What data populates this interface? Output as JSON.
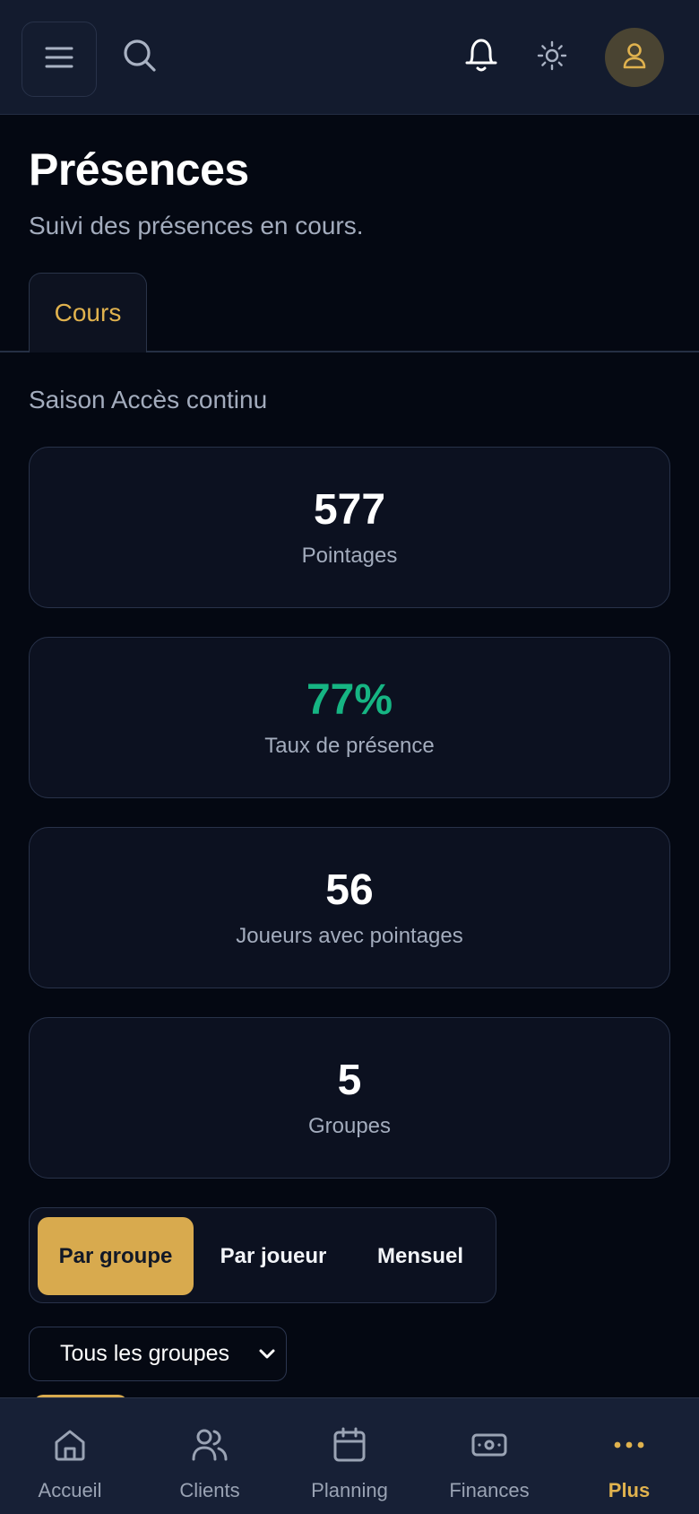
{
  "topbar": {
    "menu_icon": "hamburger-icon",
    "search_icon": "search-icon",
    "notification_icon": "bell-icon",
    "theme_icon": "sun-icon",
    "avatar_icon": "user-icon"
  },
  "header": {
    "title": "Présences",
    "subtitle": "Suivi des présences en cours."
  },
  "tabs": [
    {
      "label": "Cours",
      "active": true
    }
  ],
  "season": "Saison Accès continu",
  "stats": [
    {
      "value": "577",
      "label": "Pointages"
    },
    {
      "value": "77%",
      "label": "Taux de présence"
    },
    {
      "value": "56",
      "label": "Joueurs avec pointages"
    },
    {
      "value": "5",
      "label": "Groupes"
    }
  ],
  "view_switch": {
    "options": [
      "Par groupe",
      "Par joueur",
      "Mensuel"
    ],
    "selected": "Par groupe"
  },
  "group_filter": {
    "selected": "Tous les groupes"
  },
  "bottom_nav": [
    {
      "label": "Accueil",
      "icon": "home-icon"
    },
    {
      "label": "Clients",
      "icon": "users-icon"
    },
    {
      "label": "Planning",
      "icon": "calendar-icon"
    },
    {
      "label": "Finances",
      "icon": "banknote-icon"
    },
    {
      "label": "Plus",
      "icon": "more-dots-icon",
      "active": true
    }
  ],
  "colors": {
    "background": "#040812",
    "topbar": "#131b2e",
    "card": "#0c1120",
    "accent": "#e0b24e",
    "accent_fill": "#d8aa4e",
    "success": "#16b583",
    "muted_text": "#a3acbd"
  }
}
